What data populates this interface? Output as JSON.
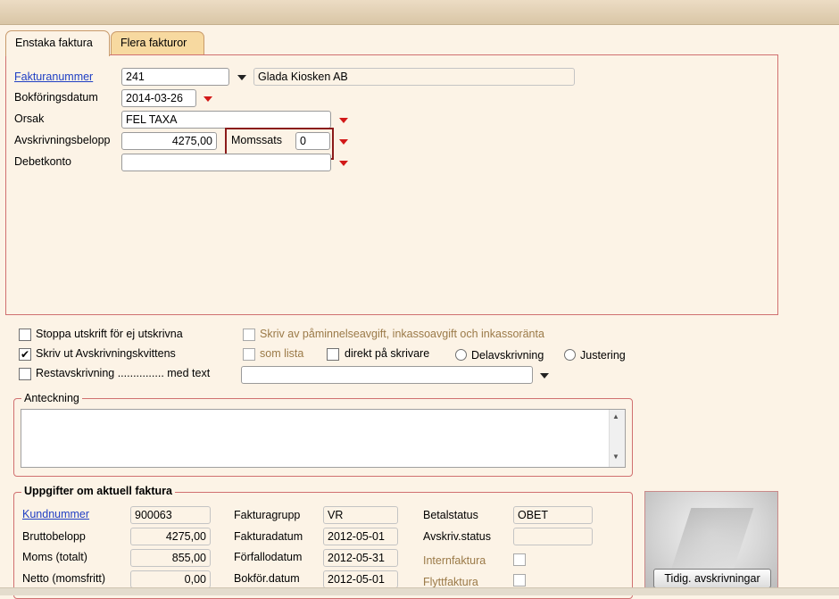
{
  "tabs": [
    {
      "label": "Enstaka faktura",
      "active": true
    },
    {
      "label": "Flera fakturor",
      "active": false
    }
  ],
  "form": {
    "fakturanummer_label": "Fakturanummer",
    "fakturanummer_value": "241",
    "customer_name": "Glada Kiosken AB",
    "bokforingsdatum_label": "Bokföringsdatum",
    "bokforingsdatum_value": "2014-03-26",
    "orsak_label": "Orsak",
    "orsak_value": "FEL TAXA",
    "avskrivningsbelopp_label": "Avskrivningsbelopp",
    "avskrivningsbelopp_value": "4275,00",
    "momssats_label": "Momssats",
    "momssats_value": "0",
    "debetkonto_label": "Debetkonto",
    "debetkonto_value": ""
  },
  "options": {
    "stoppa_label": "Stoppa utskrift för ej utskrivna",
    "stoppa_checked": false,
    "skriv_ut_label": "Skriv ut Avskrivningskvittens",
    "skriv_ut_checked": true,
    "restavskrivning_label": "Restavskrivning ............... med text",
    "restavskrivning_checked": false,
    "skriv_av_label": "Skriv av påminnelseavgift, inkassoavgift och inkassoränta",
    "som_lista_label": "som lista",
    "direkt_label": "direkt på skrivare",
    "delavskrivning_label": "Delavskrivning",
    "justering_label": "Justering",
    "restavskrivning_text": "",
    "check_mark": "✔"
  },
  "anteckning": {
    "title": "Anteckning",
    "value": ""
  },
  "invoice": {
    "title": "Uppgifter om aktuell faktura",
    "kundnummer_label": "Kundnummer",
    "kundnummer_value": "900063",
    "bruttobelopp_label": "Bruttobelopp",
    "bruttobelopp_value": "4275,00",
    "moms_label": "Moms (totalt)",
    "moms_value": "855,00",
    "netto_label": "Netto (momsfritt)",
    "netto_value": "0,00",
    "fakturagrupp_label": "Fakturagrupp",
    "fakturagrupp_value": "VR",
    "fakturadatum_label": "Fakturadatum",
    "fakturadatum_value": "2012-05-01",
    "forfallodatum_label": "Förfallodatum",
    "forfallodatum_value": "2012-05-31",
    "bokfor_label": "Bokför.datum",
    "bokfor_value": "2012-05-01",
    "betalstatus_label": "Betalstatus",
    "betalstatus_value": "OBET",
    "avskrivstatus_label": "Avskriv.status",
    "avskrivstatus_value": "",
    "internfaktura_label": "Internfaktura",
    "flyttfaktura_label": "Flyttfaktura"
  },
  "buttons": {
    "tidig_label": "Tidig. avskrivningar"
  },
  "icons": {
    "scroll_up": "▲",
    "scroll_down": "▼"
  },
  "colors": {
    "accent_red": "#d21818",
    "link_blue": "#1f3fc4",
    "panel_border": "#d07070",
    "highlight_box": "#8b1a1a"
  }
}
